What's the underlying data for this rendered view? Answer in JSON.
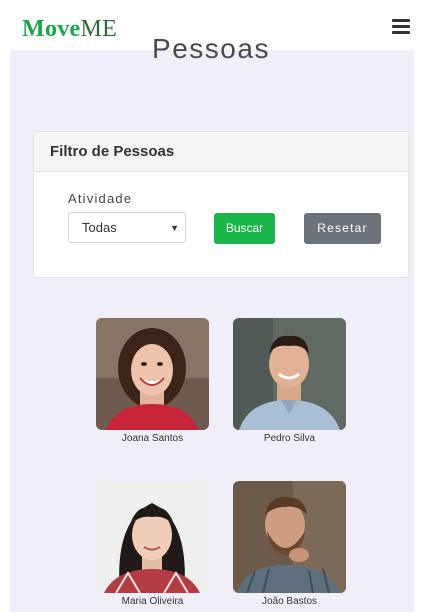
{
  "brand": {
    "part1": "Move",
    "part2": "ME",
    "color1": "#1aa64a",
    "color2": "#2f6b3a"
  },
  "nav": {
    "menu_icon": "hamburger-icon"
  },
  "page": {
    "title": "Pessoas"
  },
  "filter": {
    "header": "Filtro de Pessoas",
    "activity_label": "Atividade",
    "activity_selected": "Todas",
    "search_button": "Buscar",
    "reset_button": "Resetar"
  },
  "people": [
    {
      "name": "Joana Santos"
    },
    {
      "name": "Pedro Silva"
    },
    {
      "name": "Maria Oliveira"
    },
    {
      "name": "João Bastos"
    }
  ],
  "colors": {
    "accent": "#18b548",
    "secondary": "#6c737b",
    "background": "#f0eff9"
  }
}
